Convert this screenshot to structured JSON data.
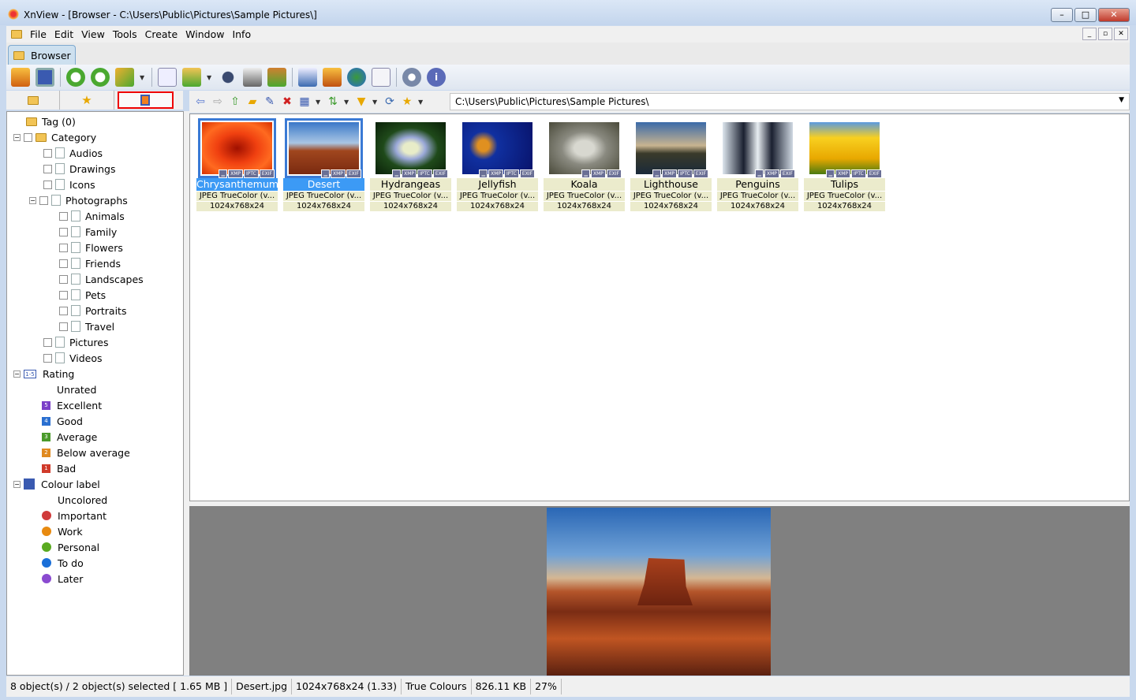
{
  "window": {
    "title": "XnView - [Browser - C:\\Users\\Public\\Pictures\\Sample Pictures\\]",
    "min": "–",
    "max": "□",
    "close": "✕"
  },
  "menu": [
    "File",
    "Edit",
    "View",
    "Tools",
    "Create",
    "Window",
    "Info"
  ],
  "tab": "Browser",
  "path": "C:\\Users\\Public\\Pictures\\Sample Pictures\\",
  "tree": {
    "tag": "Tag (0)",
    "category": "Category",
    "cat_items": [
      "Audios",
      "Drawings",
      "Icons",
      "Photographs"
    ],
    "photo_items": [
      "Animals",
      "Family",
      "Flowers",
      "Friends",
      "Landscapes",
      "Pets",
      "Portraits",
      "Travel"
    ],
    "cat_items2": [
      "Pictures",
      "Videos"
    ],
    "rating": "Rating",
    "ratings": [
      {
        "label": "Unrated",
        "n": "",
        "color": ""
      },
      {
        "label": "Excellent",
        "n": "5",
        "color": "#7a3fc8"
      },
      {
        "label": "Good",
        "n": "4",
        "color": "#2a6fd0"
      },
      {
        "label": "Average",
        "n": "3",
        "color": "#4a9a2a"
      },
      {
        "label": "Below average",
        "n": "2",
        "color": "#e08a20"
      },
      {
        "label": "Bad",
        "n": "1",
        "color": "#d03a2a"
      }
    ],
    "colour": "Colour label",
    "colours": [
      {
        "label": "Uncolored",
        "color": ""
      },
      {
        "label": "Important",
        "color": "#d03a3a"
      },
      {
        "label": "Work",
        "color": "#e88a10"
      },
      {
        "label": "Personal",
        "color": "#5aaa20"
      },
      {
        "label": "To do",
        "color": "#1a6fd8"
      },
      {
        "label": "Later",
        "color": "#8a4ad0"
      }
    ]
  },
  "thumbs": [
    {
      "name": "Chrysanthemum",
      "type": "JPEG TrueColor (v...",
      "dims": "1024x768x24",
      "badges": [
        "XMP",
        "IPTC",
        "EXIF"
      ],
      "selected": true,
      "bg": "radial-gradient(#a01000,#f04010 40%,#ff6a20 70%,#d83000)"
    },
    {
      "name": "Desert",
      "type": "JPEG TrueColor (v...",
      "dims": "1024x768x24",
      "badges": [
        "XMP",
        "EXIF"
      ],
      "selected": true,
      "bg": "linear-gradient(#3a78c8,#a9c6e4 40%,#a0461e 55%,#7a2a10)"
    },
    {
      "name": "Hydrangeas",
      "type": "JPEG TrueColor (v...",
      "dims": "1024x768x24",
      "badges": [
        "XMP",
        "IPTC",
        "EXIF"
      ],
      "selected": false,
      "bg": "radial-gradient(#e8ecc8 15%,#9aa8d8 30%,#1f4a1a 55%,#0a2008)"
    },
    {
      "name": "Jellyfish",
      "type": "JPEG TrueColor (v...",
      "dims": "1024x768x24",
      "badges": [
        "XMP",
        "IPTC",
        "EXIF"
      ],
      "selected": false,
      "bg": "radial-gradient(circle at 30% 45%,#e09020 10%,#1030a0 25%,#08126a)"
    },
    {
      "name": "Koala",
      "type": "JPEG TrueColor (v...",
      "dims": "1024x768x24",
      "badges": [
        "XMP",
        "EXIF"
      ],
      "selected": false,
      "bg": "radial-gradient(#d8d8d0 20%,#8a8a80 45%,#4a4a3a)"
    },
    {
      "name": "Lighthouse",
      "type": "JPEG TrueColor (v...",
      "dims": "1024x768x24",
      "badges": [
        "XMP",
        "IPTC",
        "EXIF"
      ],
      "selected": false,
      "bg": "linear-gradient(#3a6aa8,#c8b490 45%,#3a3a2a 60%,#1a2a3a)"
    },
    {
      "name": "Penguins",
      "type": "JPEG TrueColor (v...",
      "dims": "1024x768x24",
      "badges": [
        "XMP",
        "EXIF"
      ],
      "selected": false,
      "bg": "linear-gradient(90deg,#dde6ee,#1a2030 30%,#e8eef2 50%,#1a2030 70%,#cfd8e2)"
    },
    {
      "name": "Tulips",
      "type": "JPEG TrueColor (v...",
      "dims": "1024x768x24",
      "badges": [
        "XMP",
        "IPTC",
        "EXIF"
      ],
      "selected": false,
      "bg": "linear-gradient(#5a9ae0,#f8d020 30%,#e8a800 70%,#4a7a10)"
    }
  ],
  "status": [
    "8 object(s) / 2 object(s) selected  [ 1.65 MB ]",
    "Desert.jpg",
    "1024x768x24 (1.33)",
    "True Colours",
    "826.11 KB",
    "27%"
  ]
}
